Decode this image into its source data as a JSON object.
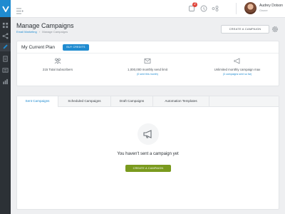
{
  "topbar": {
    "notification_count": "2",
    "user_name": "Audrey Dotson",
    "user_role": "Owner"
  },
  "page": {
    "title": "Manage Campaigns",
    "breadcrumb": [
      "Email Marketing",
      "Manage Campaigns"
    ],
    "breadcrumb_separator": "›",
    "create_button": "CREATE A CAMPAIGN"
  },
  "plan": {
    "title": "My Current Plan",
    "buy_credits": "BUY CREDITS",
    "subscribers": "215 Total Subscribers",
    "send_limit": "1,000,000 monthly send limit",
    "send_limit_link": "(0 sent this month)",
    "campaign_max": "Unlimited monthly campaign max",
    "campaign_max_link": "(3 campaigns sent so far)"
  },
  "tabs": [
    {
      "label": "Sent Campaigns",
      "active": true
    },
    {
      "label": "Scheduled Campaigns",
      "active": false
    },
    {
      "label": "Draft Campaigns",
      "active": false
    },
    {
      "label": "Automation Templates",
      "active": false
    }
  ],
  "empty_state": {
    "message": "You haven't sent a campaign yet",
    "button": "CREATE A CAMPAIGN"
  },
  "colors": {
    "accent": "#1f8bd0",
    "sidebar": "#2c3136",
    "green_button": "#7a9a1e",
    "badge": "#e0463c"
  },
  "icons": [
    "logo-icon",
    "dashboard-icon",
    "share-icon",
    "edit-icon",
    "document-icon",
    "list-icon",
    "chart-icon",
    "menu-icon",
    "notification-icon",
    "help-icon",
    "integrations-icon",
    "settings-icon",
    "subscribers-icon",
    "mail-icon",
    "megaphone-icon"
  ]
}
